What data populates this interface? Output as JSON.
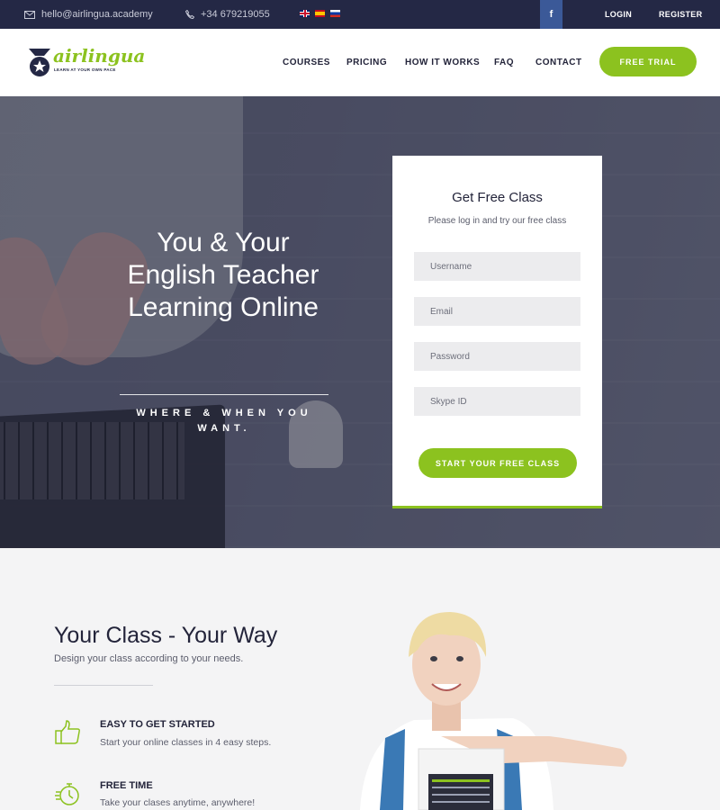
{
  "topbar": {
    "email": "hello@airlingua.academy",
    "phone": "+34 679219055",
    "flags": [
      "english-flag-icon",
      "spanish-flag-icon",
      "russian-flag-icon"
    ],
    "facebook_label": "f",
    "login_label": "LOGIN",
    "register_label": "REGISTER"
  },
  "header": {
    "logo_text": "airlingua",
    "logo_tagline": "LEARN AT YOUR OWN PACE",
    "nav": [
      "COURSES",
      "PRICING",
      "HOW IT WORKS",
      "FAQ",
      "CONTACT"
    ],
    "cta_label": "FREE TRIAL"
  },
  "hero": {
    "title": "You & Your English Teacher Learning Online",
    "subtitle": "WHERE & WHEN YOU WANT."
  },
  "form": {
    "title": "Get Free Class",
    "subtitle": "Please log in and try our free class",
    "fields": {
      "username_placeholder": "Username",
      "email_placeholder": "Email",
      "password_placeholder": "Password",
      "skype_placeholder": "Skype ID"
    },
    "submit_label": "START YOUR FREE CLASS"
  },
  "features": {
    "title": "Your Class - Your Way",
    "subtitle": "Design your class according to your needs.",
    "items": [
      {
        "icon": "thumbs-up-icon",
        "title": "EASY TO GET STARTED",
        "desc": "Start your online classes in 4 easy steps."
      },
      {
        "icon": "stopwatch-icon",
        "title": "FREE TIME",
        "desc": "Take your clases anytime, anywhere!"
      }
    ]
  },
  "colors": {
    "accent": "#8cc21f",
    "navy": "#242845",
    "facebook": "#3b5998"
  }
}
